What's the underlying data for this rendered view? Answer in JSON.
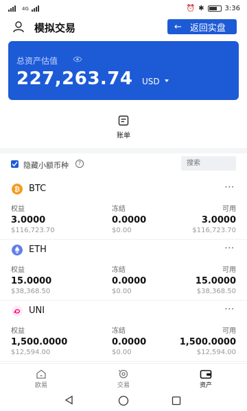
{
  "status_bar": {
    "left_text": "4G",
    "time": "3:36",
    "battery": "battery-icon"
  },
  "header": {
    "title": "模拟交易",
    "back_button": "返回实盘",
    "user_icon": "user-icon"
  },
  "asset_card": {
    "label": "总资产估值",
    "amount": "227,263.74",
    "unit": "USD",
    "color": "#1d5ad6"
  },
  "bill": {
    "label": "账单"
  },
  "filter": {
    "hide_small_label": "隐藏小额币种",
    "search_placeholder": "搜索",
    "hide_small_checked": true
  },
  "columns": {
    "equity": "权益",
    "frozen": "冻结",
    "available": "可用"
  },
  "coins": [
    {
      "symbol": "BTC",
      "equity": "3.0000",
      "equity_usd": "$116,723.70",
      "frozen": "0.0000",
      "frozen_usd": "$0.00",
      "available": "3.0000",
      "available_usd": "$116,723.70",
      "color": "#f39a1e",
      "more": "···"
    },
    {
      "symbol": "ETH",
      "equity": "15.0000",
      "equity_usd": "$38,368.50",
      "frozen": "0.0000",
      "frozen_usd": "$0.00",
      "available": "15.0000",
      "available_usd": "$38,368.50",
      "color": "#627eea",
      "more": "···"
    },
    {
      "symbol": "UNI",
      "equity": "1,500.0000",
      "equity_usd": "$12,594.00",
      "frozen": "0.0000",
      "frozen_usd": "$0.00",
      "available": "1,500.0000",
      "available_usd": "$12,594.00",
      "color": "#ff007a",
      "more": "···"
    }
  ],
  "bottom_nav": [
    {
      "label": "欧易",
      "icon": "home-icon"
    },
    {
      "label": "交易",
      "icon": "trade-icon"
    },
    {
      "label": "资产",
      "icon": "wallet-icon",
      "active": true
    }
  ]
}
